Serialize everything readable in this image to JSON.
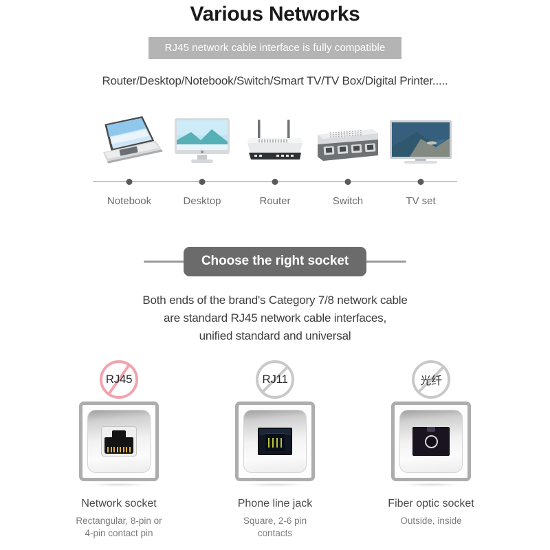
{
  "hero": {
    "title": "Various Networks",
    "banner": "RJ45 network cable interface is fully compatible",
    "subtitle": "Router/Desktop/Notebook/Switch/Smart TV/TV Box/Digital Printer....."
  },
  "devices": [
    {
      "label": "Notebook",
      "icon": "laptop-icon"
    },
    {
      "label": "Desktop",
      "icon": "desktop-monitor-icon"
    },
    {
      "label": "Router",
      "icon": "wifi-router-icon"
    },
    {
      "label": "Switch",
      "icon": "network-switch-icon"
    },
    {
      "label": "TV set",
      "icon": "television-icon"
    }
  ],
  "socket_section": {
    "pill": "Choose the right socket",
    "paragraph_lines": [
      "Both ends of the brand's Category 7/8 network cable",
      "are standard RJ45 network cable interfaces,",
      "unified standard and universal"
    ]
  },
  "sockets": [
    {
      "badge": "RJ45",
      "badge_state": "approved",
      "badge_color": "#f2a3ae",
      "title": "Network socket",
      "desc_lines": [
        "Rectangular, 8-pin or",
        "4-pin contact pin"
      ],
      "port_icon": "rj45-port-icon"
    },
    {
      "badge": "RJ11",
      "badge_state": "prohibited",
      "badge_color": "#c9c9c9",
      "title": "Phone line jack",
      "desc_lines": [
        "Square, 2-6 pin",
        "contacts"
      ],
      "port_icon": "rj11-port-icon"
    },
    {
      "badge": "光纤",
      "badge_state": "prohibited",
      "badge_color": "#c9c9c9",
      "title": "Fiber optic socket",
      "desc_lines": [
        "Outside, inside"
      ],
      "port_icon": "fiber-optic-port-icon"
    }
  ],
  "colors": {
    "banner_grey": "#b4b4b4",
    "pill_dark": "#6b6b6b",
    "text_dark": "#3d3d3d",
    "text_muted": "#6d6d6d",
    "accent_pink": "#f2a3ae"
  }
}
